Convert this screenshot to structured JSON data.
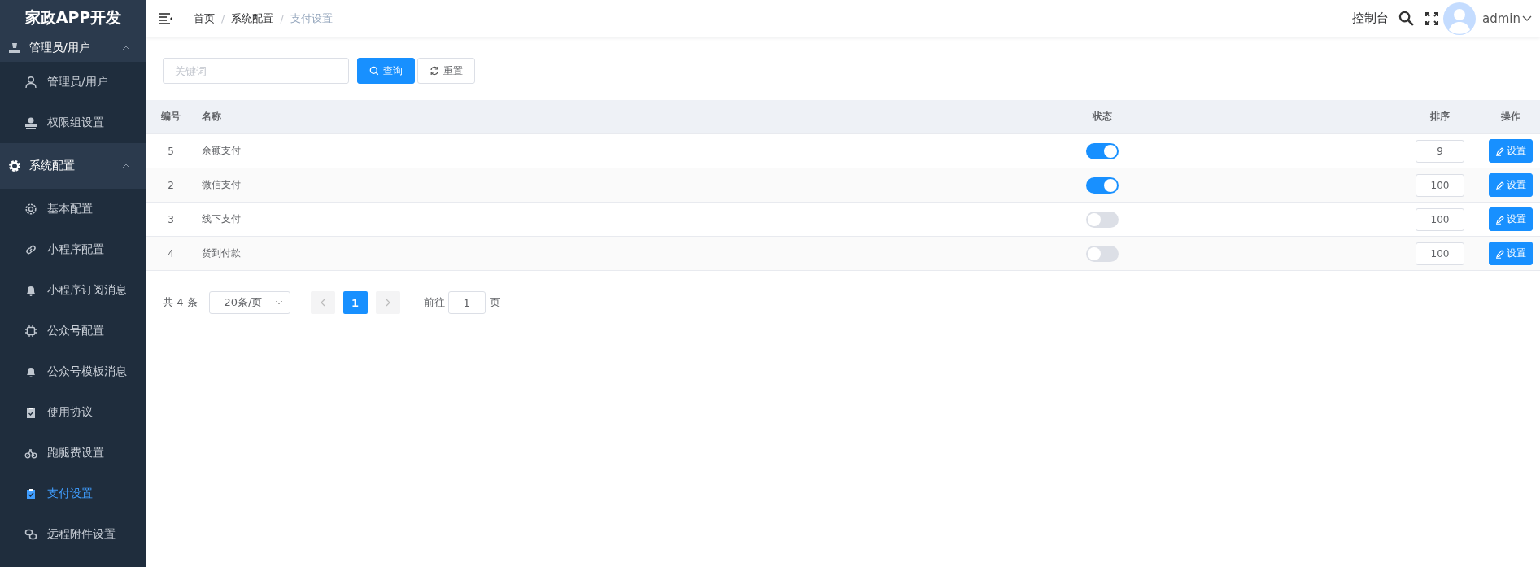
{
  "sidebar": {
    "logo": "家政APP开发",
    "groups": [
      {
        "label": "管理员/用户",
        "expanded": true,
        "children": [
          {
            "label": "管理员/用户",
            "selected": false
          },
          {
            "label": "权限组设置",
            "selected": false
          }
        ]
      },
      {
        "label": "系统配置",
        "expanded": true,
        "children": [
          {
            "label": "基本配置",
            "selected": false
          },
          {
            "label": "小程序配置",
            "selected": false
          },
          {
            "label": "小程序订阅消息",
            "selected": false
          },
          {
            "label": "公众号配置",
            "selected": false
          },
          {
            "label": "公众号模板消息",
            "selected": false
          },
          {
            "label": "使用协议",
            "selected": false
          },
          {
            "label": "跑腿费设置",
            "selected": false
          },
          {
            "label": "支付设置",
            "selected": true
          },
          {
            "label": "远程附件设置",
            "selected": false
          }
        ]
      }
    ]
  },
  "header": {
    "breadcrumb": [
      "首页",
      "系统配置",
      "支付设置"
    ],
    "separators": [
      "/",
      "/"
    ],
    "console_link": "控制台",
    "user": "admin"
  },
  "search": {
    "placeholder": "关键词",
    "query_button": "查询",
    "reset_button": "重置"
  },
  "table": {
    "columns": [
      "编号",
      "名称",
      "状态",
      "排序",
      "操作"
    ],
    "rows": [
      {
        "id": "5",
        "name": "余额支付",
        "on": true,
        "sort": "9",
        "action": "设置"
      },
      {
        "id": "2",
        "name": "微信支付",
        "on": true,
        "sort": "100",
        "action": "设置"
      },
      {
        "id": "3",
        "name": "线下支付",
        "on": false,
        "sort": "100",
        "action": "设置"
      },
      {
        "id": "4",
        "name": "货到付款",
        "on": false,
        "sort": "100",
        "action": "设置"
      }
    ]
  },
  "pagination": {
    "total": "共 4 条",
    "page_size": "20条/页",
    "pages": [
      {
        "label": "1",
        "selected": true
      }
    ],
    "goto_label": "前往",
    "goto_value": "1",
    "goto_suffix": "页"
  }
}
